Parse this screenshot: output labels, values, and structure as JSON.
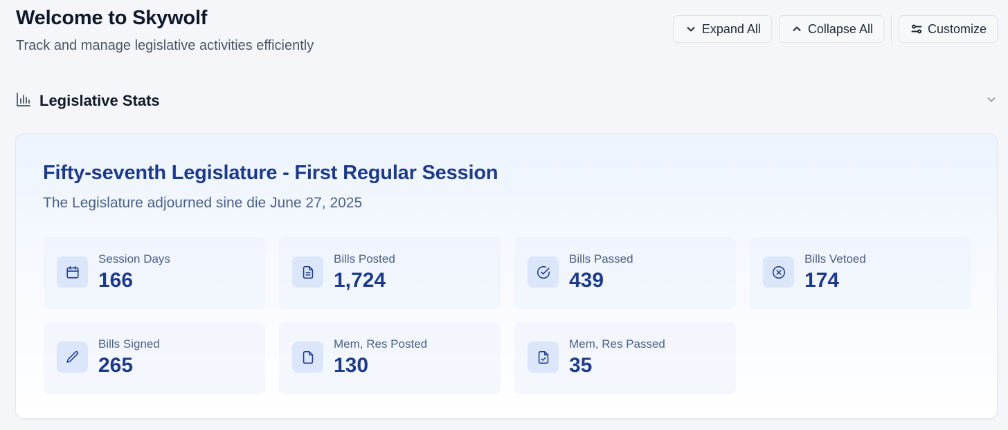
{
  "header": {
    "title": "Welcome to Skywolf",
    "subtitle": "Track and manage legislative activities efficiently"
  },
  "toolbar": {
    "expand_all": "Expand All",
    "collapse_all": "Collapse All",
    "customize": "Customize"
  },
  "section": {
    "title": "Legislative Stats",
    "icon": "bar-chart-icon"
  },
  "session": {
    "title": "Fifty-seventh Legislature - First Regular Session",
    "subtitle": "The Legislature adjourned sine die June 27, 2025"
  },
  "stats": [
    {
      "label": "Session Days",
      "value": "166",
      "icon": "calendar-icon"
    },
    {
      "label": "Bills Posted",
      "value": "1,724",
      "icon": "document-icon"
    },
    {
      "label": "Bills Passed",
      "value": "439",
      "icon": "check-circle-icon"
    },
    {
      "label": "Bills Vetoed",
      "value": "174",
      "icon": "x-circle-icon"
    },
    {
      "label": "Bills Signed",
      "value": "265",
      "icon": "pencil-icon"
    },
    {
      "label": "Mem, Res Posted",
      "value": "130",
      "icon": "file-icon"
    },
    {
      "label": "Mem, Res Passed",
      "value": "35",
      "icon": "file-check-icon"
    }
  ],
  "colors": {
    "accent": "#1e3a8a",
    "icon_bg": "#dbe6fb",
    "page_bg": "#f4f6f9"
  }
}
